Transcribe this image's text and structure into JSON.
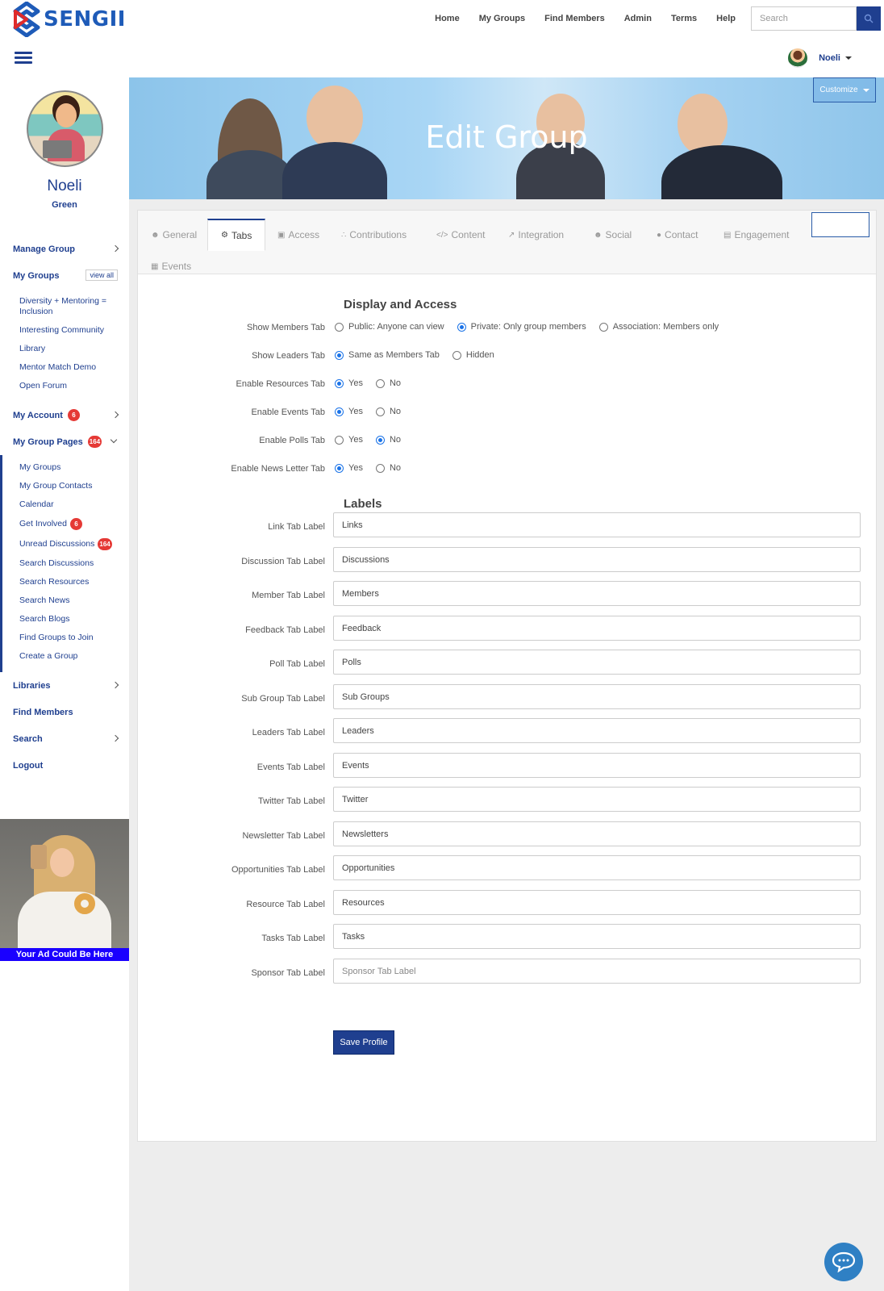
{
  "brand": {
    "name": "SENGII",
    "logo_icon": "sengii-logo-icon"
  },
  "nav": {
    "links": [
      "Home",
      "My Groups",
      "Find Members",
      "Admin",
      "Terms",
      "Help"
    ],
    "search_placeholder": "Search"
  },
  "user": {
    "name": "Noeli"
  },
  "profile": {
    "first_name": "Noeli",
    "last_name": "Green"
  },
  "sidebar": {
    "manage_group": "Manage Group",
    "my_groups": "My Groups",
    "view_all": "view all",
    "groups": [
      "Diversity + Mentoring = Inclusion",
      "Interesting Community",
      "Library",
      "Mentor Match Demo",
      "Open Forum"
    ],
    "my_account": "My Account",
    "my_account_badge": "6",
    "my_group_pages": "My Group Pages",
    "my_group_pages_badge": "164",
    "group_pages": [
      {
        "label": "My Groups",
        "badge": ""
      },
      {
        "label": "My Group Contacts",
        "badge": ""
      },
      {
        "label": "Calendar",
        "badge": ""
      },
      {
        "label": "Get Involved",
        "badge": "6"
      },
      {
        "label": "Unread Discussions",
        "badge": "164"
      },
      {
        "label": "Search Discussions",
        "badge": ""
      },
      {
        "label": "Search Resources",
        "badge": ""
      },
      {
        "label": "Search News",
        "badge": ""
      },
      {
        "label": "Search Blogs",
        "badge": ""
      },
      {
        "label": "Find Groups to Join",
        "badge": ""
      },
      {
        "label": "Create a Group",
        "badge": ""
      }
    ],
    "libraries": "Libraries",
    "find_members": "Find Members",
    "search": "Search",
    "logout": "Logout",
    "ad_label": "Your Ad Could Be Here"
  },
  "banner": {
    "title": "Edit Group",
    "customize": "Customize"
  },
  "tabs": [
    {
      "label": "General",
      "icon": "☻"
    },
    {
      "label": "Tabs",
      "icon": "⚙"
    },
    {
      "label": "Access",
      "icon": "▣"
    },
    {
      "label": "Contributions",
      "icon": "∴"
    },
    {
      "label": "Content",
      "icon": "</>"
    },
    {
      "label": "Integration",
      "icon": "↗"
    },
    {
      "label": "Social",
      "icon": "☻"
    },
    {
      "label": "Contact",
      "icon": "●"
    },
    {
      "label": "Engagement",
      "icon": "▤"
    },
    {
      "label": "Events",
      "icon": "▦"
    }
  ],
  "display_access": {
    "title": "Display and Access",
    "rows": [
      {
        "label": "Show Members Tab",
        "options": [
          "Public: Anyone can view",
          "Private: Only group members",
          "Association: Members only"
        ],
        "selected": 1
      },
      {
        "label": "Show Leaders Tab",
        "options": [
          "Same as Members Tab",
          "Hidden"
        ],
        "selected": 0
      },
      {
        "label": "Enable Resources Tab",
        "options": [
          "Yes",
          "No"
        ],
        "selected": 0
      },
      {
        "label": "Enable Events Tab",
        "options": [
          "Yes",
          "No"
        ],
        "selected": 0
      },
      {
        "label": "Enable Polls Tab",
        "options": [
          "Yes",
          "No"
        ],
        "selected": 1
      },
      {
        "label": "Enable News Letter Tab",
        "options": [
          "Yes",
          "No"
        ],
        "selected": 0
      }
    ]
  },
  "labels": {
    "title": "Labels",
    "fields": [
      {
        "label": "Link Tab Label",
        "value": "Links",
        "placeholder": ""
      },
      {
        "label": "Discussion Tab Label",
        "value": "Discussions",
        "placeholder": ""
      },
      {
        "label": "Member Tab Label",
        "value": "Members",
        "placeholder": ""
      },
      {
        "label": "Feedback Tab Label",
        "value": "Feedback",
        "placeholder": ""
      },
      {
        "label": "Poll Tab Label",
        "value": "Polls",
        "placeholder": ""
      },
      {
        "label": "Sub Group Tab Label",
        "value": "Sub Groups",
        "placeholder": ""
      },
      {
        "label": "Leaders Tab Label",
        "value": "Leaders",
        "placeholder": ""
      },
      {
        "label": "Events Tab Label",
        "value": "Events",
        "placeholder": ""
      },
      {
        "label": "Twitter Tab Label",
        "value": "Twitter",
        "placeholder": ""
      },
      {
        "label": "Newsletter Tab Label",
        "value": "Newsletters",
        "placeholder": ""
      },
      {
        "label": "Opportunities Tab Label",
        "value": "Opportunities",
        "placeholder": ""
      },
      {
        "label": "Resource Tab Label",
        "value": "Resources",
        "placeholder": ""
      },
      {
        "label": "Tasks Tab Label",
        "value": "Tasks",
        "placeholder": ""
      },
      {
        "label": "Sponsor Tab Label",
        "value": "",
        "placeholder": "Sponsor Tab Label"
      }
    ]
  },
  "save_button": "Save Profile",
  "colors": {
    "brand_blue": "#1f3f8f",
    "badge_red": "#e53935",
    "ad_blue": "#1a00ff"
  }
}
